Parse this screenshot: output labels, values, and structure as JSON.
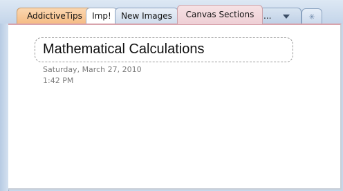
{
  "tabs": [
    {
      "label": "AddictiveTips"
    },
    {
      "label": "Imp!"
    },
    {
      "label": "New Images"
    },
    {
      "label": "Canvas Sections"
    }
  ],
  "overflow_label": "...",
  "new_section_icon": "new-section-icon",
  "page": {
    "title": "Mathematical Calculations",
    "date": "Saturday, March 27, 2010",
    "time": "1:42 PM"
  },
  "colors": {
    "tab_addictive": "#f5bb84",
    "tab_canvas_active": "#eecfd5",
    "page_top_border": "#d8a3ac"
  }
}
